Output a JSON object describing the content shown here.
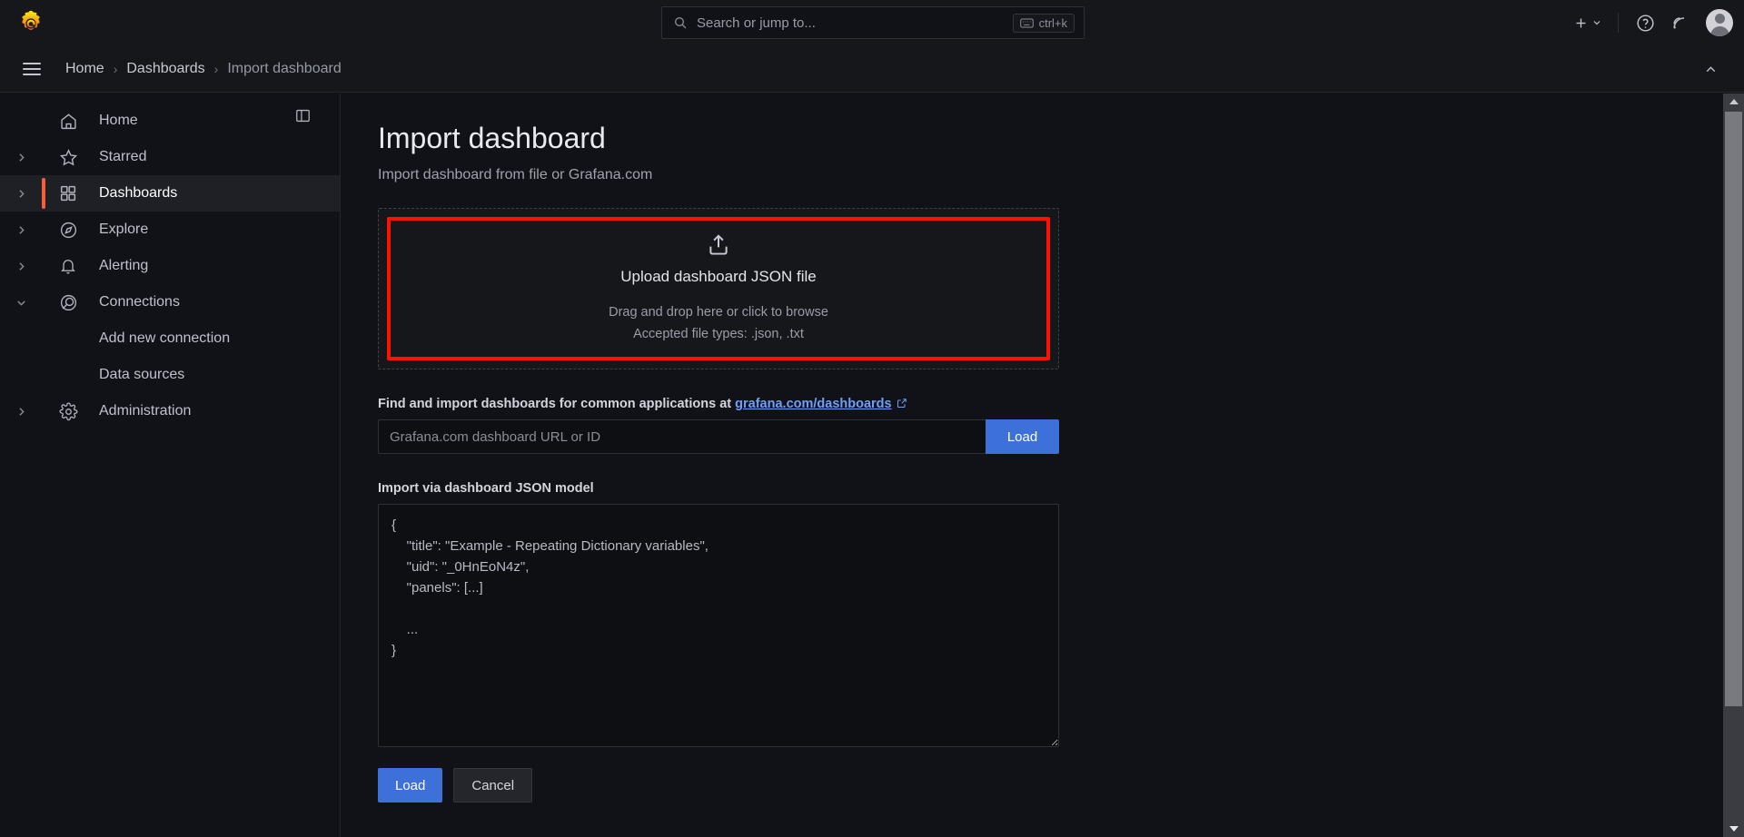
{
  "colors": {
    "brand_orange": "#f55f3e",
    "accent_blue": "#3d71d9",
    "link_blue": "#6e9fff",
    "highlight_red": "#ff1100",
    "bg_canvas": "#111217",
    "bg_panel": "#16171b"
  },
  "topbar": {
    "logo_name": "grafana-logo",
    "search": {
      "icon": "search-icon",
      "placeholder": "Search or jump to...",
      "shortcut_icon": "keyboard-icon",
      "shortcut_label": "ctrl+k"
    },
    "actions": {
      "new_label": "+",
      "new_chevron": "⌄",
      "help_label": "?",
      "news_label": "news-icon",
      "profile_label": "avatar"
    }
  },
  "breadcrumb": {
    "menu_icon": "hamburger-icon",
    "items": [
      {
        "label": "Home",
        "active": false
      },
      {
        "label": "Dashboards",
        "active": false
      },
      {
        "label": "Import dashboard",
        "active": true
      }
    ],
    "separator": "›",
    "collapse_icon": "chevron-up-icon"
  },
  "sidebar": {
    "dock_toggle_icon": "dock-panel-icon",
    "items": [
      {
        "label": "Home",
        "icon": "home-icon",
        "has_chevron": false,
        "expanded": false,
        "active": false,
        "child": false
      },
      {
        "label": "Starred",
        "icon": "star-icon",
        "has_chevron": true,
        "expanded": false,
        "active": false,
        "child": false
      },
      {
        "label": "Dashboards",
        "icon": "dashboards-grid-icon",
        "has_chevron": true,
        "expanded": false,
        "active": true,
        "child": false
      },
      {
        "label": "Explore",
        "icon": "compass-icon",
        "has_chevron": true,
        "expanded": false,
        "active": false,
        "child": false
      },
      {
        "label": "Alerting",
        "icon": "bell-icon",
        "has_chevron": true,
        "expanded": false,
        "active": false,
        "child": false
      },
      {
        "label": "Connections",
        "icon": "connections-icon",
        "has_chevron": true,
        "expanded": true,
        "active": false,
        "child": false
      },
      {
        "label": "Add new connection",
        "icon": "",
        "has_chevron": false,
        "expanded": false,
        "active": false,
        "child": true
      },
      {
        "label": "Data sources",
        "icon": "",
        "has_chevron": false,
        "expanded": false,
        "active": false,
        "child": true
      },
      {
        "label": "Administration",
        "icon": "gear-icon",
        "has_chevron": true,
        "expanded": false,
        "active": false,
        "child": false
      }
    ]
  },
  "page": {
    "title": "Import dashboard",
    "subtitle": "Import dashboard from file or Grafana.com"
  },
  "dropzone": {
    "icon": "upload-icon",
    "title": "Upload dashboard JSON file",
    "hint": "Drag and drop here or click to browse",
    "accepted": "Accepted file types: .json, .txt"
  },
  "gcom": {
    "label_prefix": "Find and import dashboards for common applications at ",
    "link_text": "grafana.com/dashboards",
    "link_icon": "external-link-icon",
    "input_placeholder": "Grafana.com dashboard URL or ID",
    "input_value": "",
    "load_button": "Load"
  },
  "json_model": {
    "label": "Import via dashboard JSON model",
    "value": "{\n    \"title\": \"Example - Repeating Dictionary variables\",\n    \"uid\": \"_0HnEoN4z\",\n    \"panels\": [...]\n\n    ...\n}",
    "placeholder": ""
  },
  "footer": {
    "load_button": "Load",
    "cancel_button": "Cancel"
  },
  "scrollbar": {
    "up_icon": "scroll-up-arrow",
    "down_icon": "scroll-down-arrow"
  }
}
